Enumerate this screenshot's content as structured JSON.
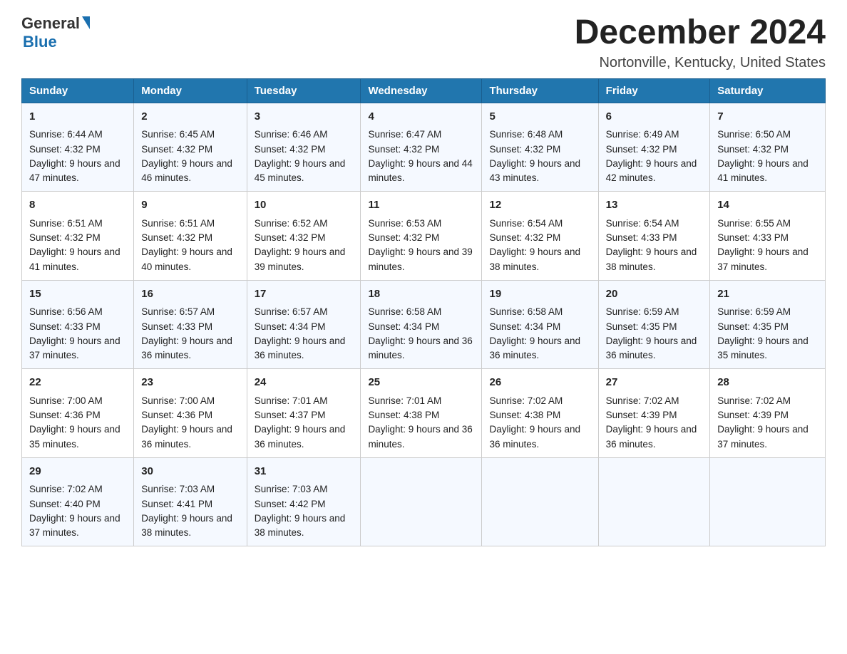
{
  "logo": {
    "text_general": "General",
    "text_blue": "Blue"
  },
  "header": {
    "title": "December 2024",
    "subtitle": "Nortonville, Kentucky, United States"
  },
  "days_of_week": [
    "Sunday",
    "Monday",
    "Tuesday",
    "Wednesday",
    "Thursday",
    "Friday",
    "Saturday"
  ],
  "weeks": [
    [
      {
        "day": "1",
        "sunrise": "6:44 AM",
        "sunset": "4:32 PM",
        "daylight": "9 hours and 47 minutes."
      },
      {
        "day": "2",
        "sunrise": "6:45 AM",
        "sunset": "4:32 PM",
        "daylight": "9 hours and 46 minutes."
      },
      {
        "day": "3",
        "sunrise": "6:46 AM",
        "sunset": "4:32 PM",
        "daylight": "9 hours and 45 minutes."
      },
      {
        "day": "4",
        "sunrise": "6:47 AM",
        "sunset": "4:32 PM",
        "daylight": "9 hours and 44 minutes."
      },
      {
        "day": "5",
        "sunrise": "6:48 AM",
        "sunset": "4:32 PM",
        "daylight": "9 hours and 43 minutes."
      },
      {
        "day": "6",
        "sunrise": "6:49 AM",
        "sunset": "4:32 PM",
        "daylight": "9 hours and 42 minutes."
      },
      {
        "day": "7",
        "sunrise": "6:50 AM",
        "sunset": "4:32 PM",
        "daylight": "9 hours and 41 minutes."
      }
    ],
    [
      {
        "day": "8",
        "sunrise": "6:51 AM",
        "sunset": "4:32 PM",
        "daylight": "9 hours and 41 minutes."
      },
      {
        "day": "9",
        "sunrise": "6:51 AM",
        "sunset": "4:32 PM",
        "daylight": "9 hours and 40 minutes."
      },
      {
        "day": "10",
        "sunrise": "6:52 AM",
        "sunset": "4:32 PM",
        "daylight": "9 hours and 39 minutes."
      },
      {
        "day": "11",
        "sunrise": "6:53 AM",
        "sunset": "4:32 PM",
        "daylight": "9 hours and 39 minutes."
      },
      {
        "day": "12",
        "sunrise": "6:54 AM",
        "sunset": "4:32 PM",
        "daylight": "9 hours and 38 minutes."
      },
      {
        "day": "13",
        "sunrise": "6:54 AM",
        "sunset": "4:33 PM",
        "daylight": "9 hours and 38 minutes."
      },
      {
        "day": "14",
        "sunrise": "6:55 AM",
        "sunset": "4:33 PM",
        "daylight": "9 hours and 37 minutes."
      }
    ],
    [
      {
        "day": "15",
        "sunrise": "6:56 AM",
        "sunset": "4:33 PM",
        "daylight": "9 hours and 37 minutes."
      },
      {
        "day": "16",
        "sunrise": "6:57 AM",
        "sunset": "4:33 PM",
        "daylight": "9 hours and 36 minutes."
      },
      {
        "day": "17",
        "sunrise": "6:57 AM",
        "sunset": "4:34 PM",
        "daylight": "9 hours and 36 minutes."
      },
      {
        "day": "18",
        "sunrise": "6:58 AM",
        "sunset": "4:34 PM",
        "daylight": "9 hours and 36 minutes."
      },
      {
        "day": "19",
        "sunrise": "6:58 AM",
        "sunset": "4:34 PM",
        "daylight": "9 hours and 36 minutes."
      },
      {
        "day": "20",
        "sunrise": "6:59 AM",
        "sunset": "4:35 PM",
        "daylight": "9 hours and 36 minutes."
      },
      {
        "day": "21",
        "sunrise": "6:59 AM",
        "sunset": "4:35 PM",
        "daylight": "9 hours and 35 minutes."
      }
    ],
    [
      {
        "day": "22",
        "sunrise": "7:00 AM",
        "sunset": "4:36 PM",
        "daylight": "9 hours and 35 minutes."
      },
      {
        "day": "23",
        "sunrise": "7:00 AM",
        "sunset": "4:36 PM",
        "daylight": "9 hours and 36 minutes."
      },
      {
        "day": "24",
        "sunrise": "7:01 AM",
        "sunset": "4:37 PM",
        "daylight": "9 hours and 36 minutes."
      },
      {
        "day": "25",
        "sunrise": "7:01 AM",
        "sunset": "4:38 PM",
        "daylight": "9 hours and 36 minutes."
      },
      {
        "day": "26",
        "sunrise": "7:02 AM",
        "sunset": "4:38 PM",
        "daylight": "9 hours and 36 minutes."
      },
      {
        "day": "27",
        "sunrise": "7:02 AM",
        "sunset": "4:39 PM",
        "daylight": "9 hours and 36 minutes."
      },
      {
        "day": "28",
        "sunrise": "7:02 AM",
        "sunset": "4:39 PM",
        "daylight": "9 hours and 37 minutes."
      }
    ],
    [
      {
        "day": "29",
        "sunrise": "7:02 AM",
        "sunset": "4:40 PM",
        "daylight": "9 hours and 37 minutes."
      },
      {
        "day": "30",
        "sunrise": "7:03 AM",
        "sunset": "4:41 PM",
        "daylight": "9 hours and 38 minutes."
      },
      {
        "day": "31",
        "sunrise": "7:03 AM",
        "sunset": "4:42 PM",
        "daylight": "9 hours and 38 minutes."
      },
      {
        "day": "",
        "sunrise": "",
        "sunset": "",
        "daylight": ""
      },
      {
        "day": "",
        "sunrise": "",
        "sunset": "",
        "daylight": ""
      },
      {
        "day": "",
        "sunrise": "",
        "sunset": "",
        "daylight": ""
      },
      {
        "day": "",
        "sunrise": "",
        "sunset": "",
        "daylight": ""
      }
    ]
  ],
  "labels": {
    "sunrise_prefix": "Sunrise: ",
    "sunset_prefix": "Sunset: ",
    "daylight_prefix": "Daylight: "
  }
}
